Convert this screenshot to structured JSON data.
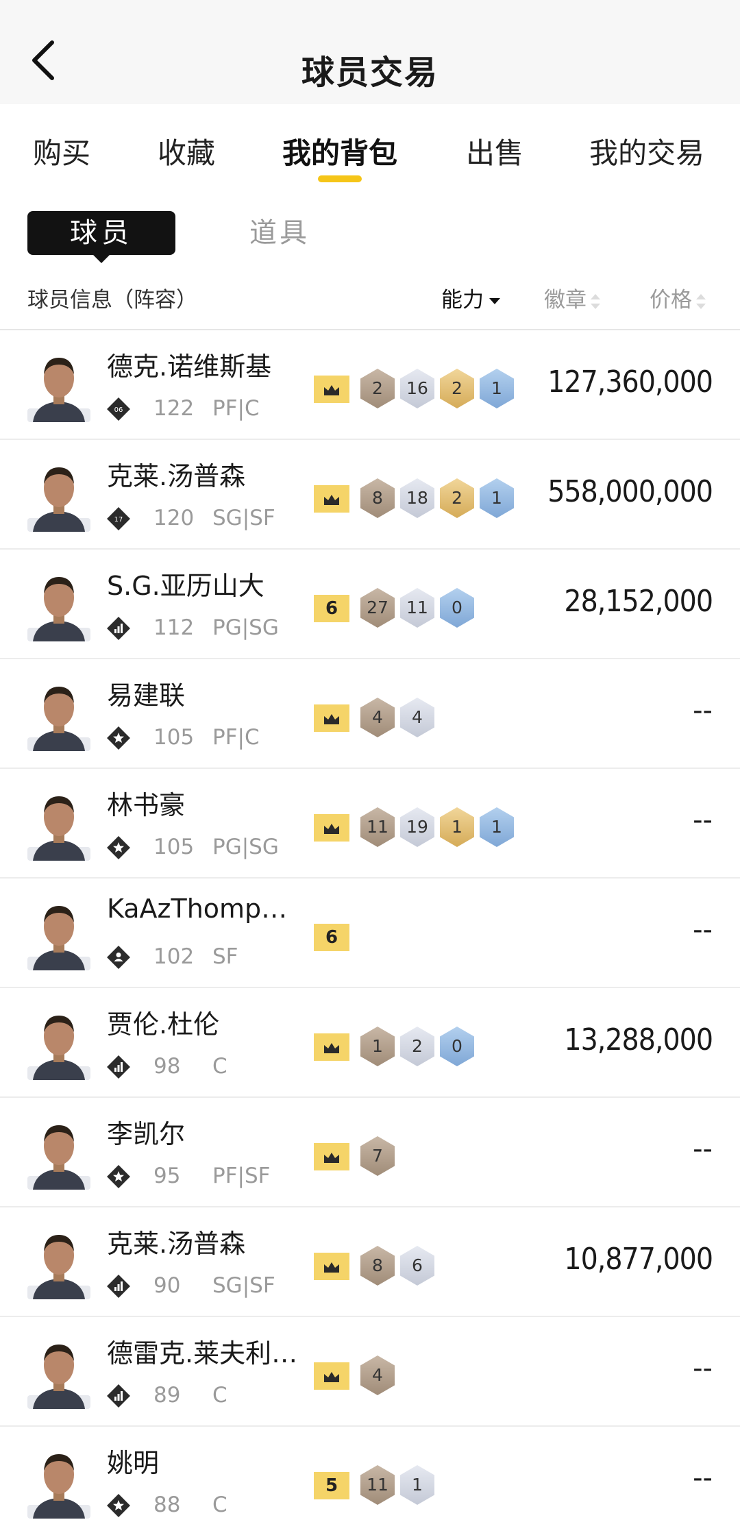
{
  "header": {
    "title": "球员交易"
  },
  "tabs": [
    "购买",
    "收藏",
    "我的背包",
    "出售",
    "我的交易"
  ],
  "active_tab_index": 2,
  "subtabs": {
    "active": "球员",
    "other": "道具"
  },
  "columns": {
    "info": "球员信息（阵容）",
    "ability": "能力",
    "badges": "徽章",
    "price": "价格"
  },
  "colors": {
    "accent": "#f5c518",
    "crown_bg": "#f5d468"
  },
  "players": [
    {
      "name": "德克.诺维斯基",
      "tier_icon": "tier-06-icon",
      "tier_label": "06",
      "ovr": "122",
      "pos": "PF|C",
      "badges": [
        {
          "type": "crown"
        },
        {
          "type": "bronze",
          "n": "2"
        },
        {
          "type": "silver",
          "n": "16"
        },
        {
          "type": "gold",
          "n": "2"
        },
        {
          "type": "blue",
          "n": "1"
        }
      ],
      "price": "127,360,000"
    },
    {
      "name": "克莱.汤普森",
      "tier_icon": "tier-17-icon",
      "tier_label": "17",
      "ovr": "120",
      "pos": "SG|SF",
      "badges": [
        {
          "type": "crown"
        },
        {
          "type": "bronze",
          "n": "8"
        },
        {
          "type": "silver",
          "n": "18"
        },
        {
          "type": "gold",
          "n": "2"
        },
        {
          "type": "blue",
          "n": "1"
        }
      ],
      "price": "558,000,000"
    },
    {
      "name": "S.G.亚历山大",
      "tier_icon": "tier-bars-icon",
      "ovr": "112",
      "pos": "PG|SG",
      "badges": [
        {
          "type": "num",
          "n": "6"
        },
        {
          "type": "bronze",
          "n": "27"
        },
        {
          "type": "silver",
          "n": "11"
        },
        {
          "type": "blue",
          "n": "0"
        }
      ],
      "price": "28,152,000"
    },
    {
      "name": "易建联",
      "tier_icon": "tier-star-icon",
      "ovr": "105",
      "pos": "PF|C",
      "badges": [
        {
          "type": "crown"
        },
        {
          "type": "bronze",
          "n": "4"
        },
        {
          "type": "silver",
          "n": "4"
        }
      ],
      "price": "--"
    },
    {
      "name": "林书豪",
      "tier_icon": "tier-star-icon",
      "ovr": "105",
      "pos": "PG|SG",
      "badges": [
        {
          "type": "crown"
        },
        {
          "type": "bronze",
          "n": "11"
        },
        {
          "type": "silver",
          "n": "19"
        },
        {
          "type": "gold",
          "n": "1"
        },
        {
          "type": "blue",
          "n": "1"
        }
      ],
      "price": "--"
    },
    {
      "name": "KaAzThompson",
      "tier_icon": "tier-person-icon",
      "ovr": "102",
      "pos": "SF",
      "badges": [
        {
          "type": "num",
          "n": "6"
        }
      ],
      "price": "--"
    },
    {
      "name": "贾伦.杜伦",
      "tier_icon": "tier-bars-icon",
      "ovr": "98",
      "pos": "C",
      "badges": [
        {
          "type": "crown"
        },
        {
          "type": "bronze",
          "n": "1"
        },
        {
          "type": "silver",
          "n": "2"
        },
        {
          "type": "blue",
          "n": "0"
        }
      ],
      "price": "13,288,000"
    },
    {
      "name": "李凯尔",
      "tier_icon": "tier-star-icon",
      "ovr": "95",
      "pos": "PF|SF",
      "badges": [
        {
          "type": "crown"
        },
        {
          "type": "bronze",
          "n": "7"
        }
      ],
      "price": "--"
    },
    {
      "name": "克莱.汤普森",
      "tier_icon": "tier-bars-icon",
      "ovr": "90",
      "pos": "SG|SF",
      "badges": [
        {
          "type": "crown"
        },
        {
          "type": "bronze",
          "n": "8"
        },
        {
          "type": "silver",
          "n": "6"
        }
      ],
      "price": "10,877,000"
    },
    {
      "name": "德雷克.莱夫利…",
      "tier_icon": "tier-bars-icon",
      "ovr": "89",
      "pos": "C",
      "badges": [
        {
          "type": "crown"
        },
        {
          "type": "bronze",
          "n": "4"
        }
      ],
      "price": "--"
    },
    {
      "name": "姚明",
      "tier_icon": "tier-star-icon",
      "ovr": "88",
      "pos": "C",
      "badges": [
        {
          "type": "num",
          "n": "5"
        },
        {
          "type": "bronze",
          "n": "11"
        },
        {
          "type": "silver",
          "n": "1"
        }
      ],
      "price": "--"
    }
  ]
}
